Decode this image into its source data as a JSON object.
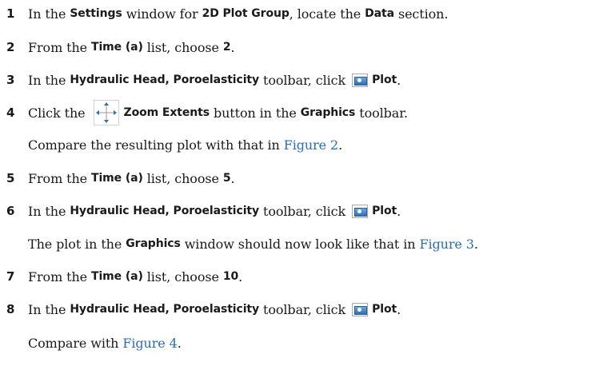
{
  "steps": [
    {
      "number": "1",
      "t1": "In the ",
      "ui1": "Settings",
      "t2": " window for ",
      "ui2": "2D Plot Group",
      "t3": ", locate the ",
      "ui3": "Data",
      "t4": " section."
    },
    {
      "number": "2",
      "t1": "From the ",
      "ui1": "Time (a)",
      "t2": " list, choose ",
      "ui2": "2",
      "t3": "."
    },
    {
      "number": "3",
      "t1": "In the ",
      "ui1": "Hydraulic Head, Poroelasticity",
      "t2": " toolbar, click ",
      "icon": "plot-icon",
      "ui2": "Plot",
      "t3": "."
    },
    {
      "number": "4",
      "t1": "Click the ",
      "icon": "zoom-extents-icon",
      "ui1": "Zoom Extents",
      "t2": " button in the ",
      "ui2": "Graphics",
      "t3": " toolbar."
    },
    {
      "continuation": true,
      "t1": "Compare the resulting plot with that in ",
      "link": "Figure 2",
      "t2": "."
    },
    {
      "number": "5",
      "t1": "From the ",
      "ui1": "Time (a)",
      "t2": " list, choose ",
      "ui2": "5",
      "t3": "."
    },
    {
      "number": "6",
      "t1": "In the ",
      "ui1": "Hydraulic Head, Poroelasticity",
      "t2": " toolbar, click ",
      "icon": "plot-icon",
      "ui2": "Plot",
      "t3": "."
    },
    {
      "continuation": true,
      "t1": "The plot in the ",
      "ui1": "Graphics",
      "t2": " window should now look like that in ",
      "link": "Figure 3",
      "t3": "."
    },
    {
      "number": "7",
      "t1": "From the ",
      "ui1": "Time (a)",
      "t2": " list, choose ",
      "ui2": "10",
      "t3": "."
    },
    {
      "number": "8",
      "t1": "In the ",
      "ui1": "Hydraulic Head, Poroelasticity",
      "t2": " toolbar, click ",
      "icon": "plot-icon",
      "ui2": "Plot",
      "t3": "."
    },
    {
      "continuation": true,
      "t1": "Compare with ",
      "link": "Figure 4",
      "t2": "."
    }
  ],
  "colors": {
    "text": "#1a1a1a",
    "link": "#2a6bb8",
    "icon_blue": "#2d6fb8"
  }
}
